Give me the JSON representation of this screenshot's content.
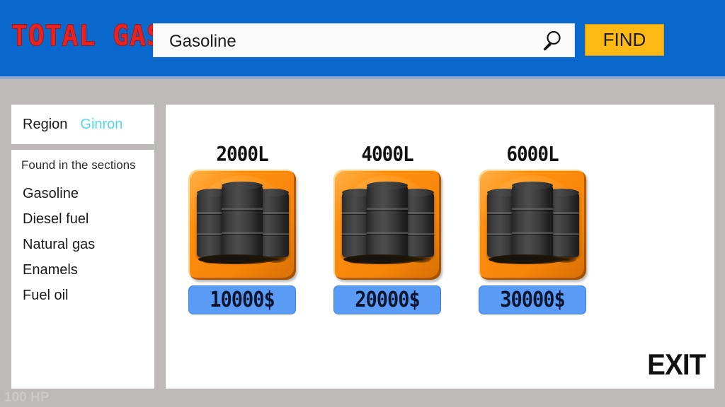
{
  "header": {
    "logo": "TOTAL GAS",
    "search": {
      "value": "Gasoline",
      "placeholder": "Gasoline",
      "icon": "search-icon"
    },
    "find_label": "FIND",
    "background_color": "#0a68cd",
    "find_color": "#fdb913",
    "logo_color": "#e8231f"
  },
  "sidebar": {
    "region_label": "Region",
    "region_value": "Ginron",
    "region_value_color": "#4fd8e8",
    "sections_title": "Found in the sections",
    "sections": [
      {
        "label": "Gasoline"
      },
      {
        "label": "Diesel fuel"
      },
      {
        "label": "Natural gas"
      },
      {
        "label": "Enamels"
      },
      {
        "label": "Fuel oil"
      }
    ]
  },
  "main": {
    "products": [
      {
        "volume": "2000L",
        "price": "10000$"
      },
      {
        "volume": "4000L",
        "price": "20000$"
      },
      {
        "volume": "6000L",
        "price": "30000$"
      }
    ],
    "exit_label": "EXIT",
    "tile_color": "#f58409",
    "price_color": "#5a9bf6"
  },
  "status": {
    "hp": "100 HP"
  }
}
